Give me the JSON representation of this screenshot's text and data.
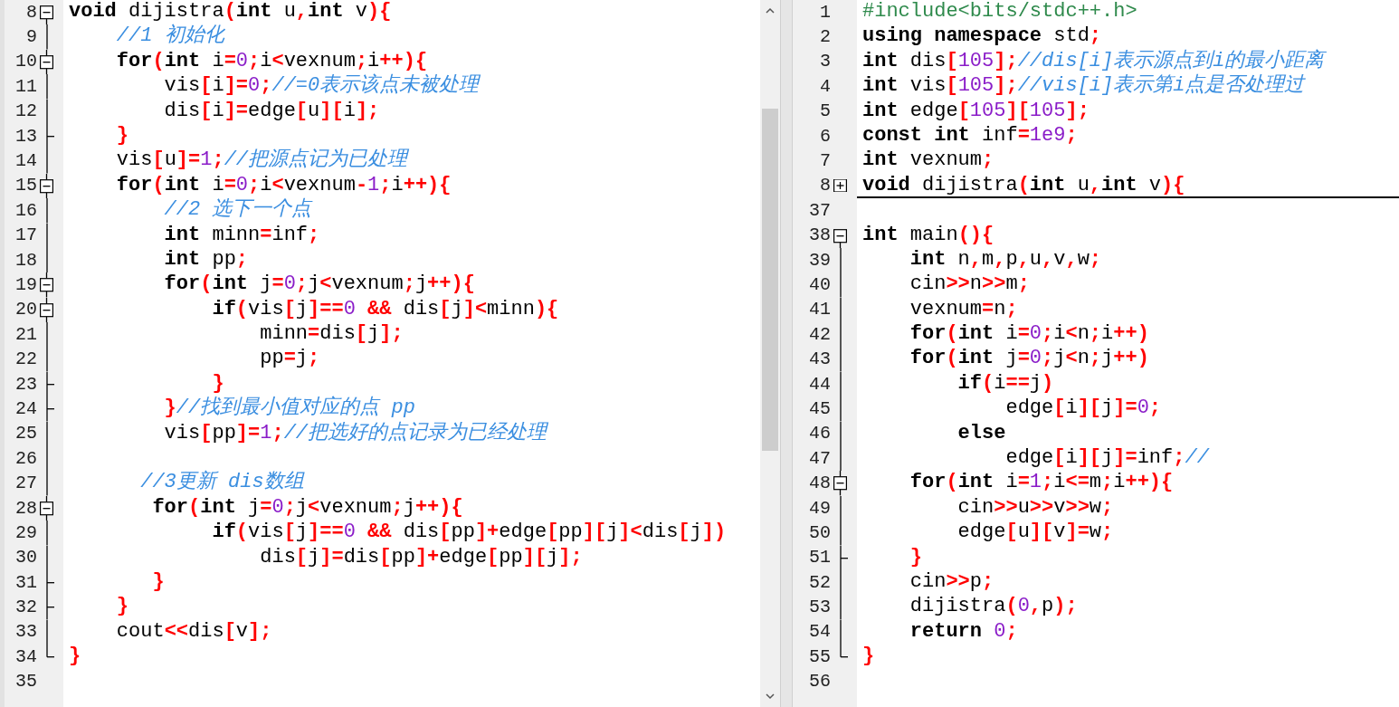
{
  "left_pane": {
    "lines": [
      {
        "number": "8",
        "kind": "start",
        "tokens": [
          {
            "kind": "keyword",
            "text": "void"
          },
          {
            "kind": "plain",
            "text": " dijistra"
          },
          {
            "kind": "symbol",
            "text": "("
          },
          {
            "kind": "keyword",
            "text": "int"
          },
          {
            "kind": "plain",
            "text": " u"
          },
          {
            "kind": "symbol",
            "text": ","
          },
          {
            "kind": "keyword",
            "text": "int"
          },
          {
            "kind": "plain",
            "text": " v"
          },
          {
            "kind": "symbol",
            "text": "){"
          }
        ]
      },
      {
        "number": "9",
        "kind": "line",
        "tokens": [
          {
            "kind": "comment",
            "text": "    //1 初始化"
          }
        ]
      },
      {
        "number": "10",
        "kind": "open",
        "tokens": [
          {
            "kind": "keyword",
            "text": "    for"
          },
          {
            "kind": "symbol",
            "text": "("
          },
          {
            "kind": "keyword",
            "text": "int"
          },
          {
            "kind": "plain",
            "text": " i"
          },
          {
            "kind": "symbol",
            "text": "="
          },
          {
            "kind": "number",
            "text": "0"
          },
          {
            "kind": "symbol",
            "text": ";"
          },
          {
            "kind": "plain",
            "text": "i"
          },
          {
            "kind": "symbol",
            "text": "<"
          },
          {
            "kind": "plain",
            "text": "vexnum"
          },
          {
            "kind": "symbol",
            "text": ";"
          },
          {
            "kind": "plain",
            "text": "i"
          },
          {
            "kind": "symbol",
            "text": "++){"
          }
        ]
      },
      {
        "number": "11",
        "kind": "line",
        "tokens": [
          {
            "kind": "plain",
            "text": "        vis"
          },
          {
            "kind": "symbol",
            "text": "["
          },
          {
            "kind": "plain",
            "text": "i"
          },
          {
            "kind": "symbol",
            "text": "]="
          },
          {
            "kind": "number",
            "text": "0"
          },
          {
            "kind": "symbol",
            "text": ";"
          },
          {
            "kind": "comment",
            "text": "//=0表示该点未被处理"
          }
        ]
      },
      {
        "number": "12",
        "kind": "line",
        "tokens": [
          {
            "kind": "plain",
            "text": "        dis"
          },
          {
            "kind": "symbol",
            "text": "["
          },
          {
            "kind": "plain",
            "text": "i"
          },
          {
            "kind": "symbol",
            "text": "]="
          },
          {
            "kind": "plain",
            "text": "edge"
          },
          {
            "kind": "symbol",
            "text": "["
          },
          {
            "kind": "plain",
            "text": "u"
          },
          {
            "kind": "symbol",
            "text": "]["
          },
          {
            "kind": "plain",
            "text": "i"
          },
          {
            "kind": "symbol",
            "text": "];"
          }
        ]
      },
      {
        "number": "13",
        "kind": "mid",
        "tokens": [
          {
            "kind": "symbol",
            "text": "    }"
          }
        ]
      },
      {
        "number": "14",
        "kind": "line",
        "tokens": [
          {
            "kind": "plain",
            "text": "    vis"
          },
          {
            "kind": "symbol",
            "text": "["
          },
          {
            "kind": "plain",
            "text": "u"
          },
          {
            "kind": "symbol",
            "text": "]="
          },
          {
            "kind": "number",
            "text": "1"
          },
          {
            "kind": "symbol",
            "text": ";"
          },
          {
            "kind": "comment",
            "text": "//把源点记为已处理"
          }
        ]
      },
      {
        "number": "15",
        "kind": "open",
        "tokens": [
          {
            "kind": "keyword",
            "text": "    for"
          },
          {
            "kind": "symbol",
            "text": "("
          },
          {
            "kind": "keyword",
            "text": "int"
          },
          {
            "kind": "plain",
            "text": " i"
          },
          {
            "kind": "symbol",
            "text": "="
          },
          {
            "kind": "number",
            "text": "0"
          },
          {
            "kind": "symbol",
            "text": ";"
          },
          {
            "kind": "plain",
            "text": "i"
          },
          {
            "kind": "symbol",
            "text": "<"
          },
          {
            "kind": "plain",
            "text": "vexnum"
          },
          {
            "kind": "symbol",
            "text": "-"
          },
          {
            "kind": "number",
            "text": "1"
          },
          {
            "kind": "symbol",
            "text": ";"
          },
          {
            "kind": "plain",
            "text": "i"
          },
          {
            "kind": "symbol",
            "text": "++){"
          }
        ]
      },
      {
        "number": "16",
        "kind": "line",
        "tokens": [
          {
            "kind": "comment",
            "text": "        //2 选下一个点"
          }
        ]
      },
      {
        "number": "17",
        "kind": "line",
        "tokens": [
          {
            "kind": "keyword",
            "text": "        int"
          },
          {
            "kind": "plain",
            "text": " minn"
          },
          {
            "kind": "symbol",
            "text": "="
          },
          {
            "kind": "plain",
            "text": "inf"
          },
          {
            "kind": "symbol",
            "text": ";"
          }
        ]
      },
      {
        "number": "18",
        "kind": "line",
        "tokens": [
          {
            "kind": "keyword",
            "text": "        int"
          },
          {
            "kind": "plain",
            "text": " pp"
          },
          {
            "kind": "symbol",
            "text": ";"
          }
        ]
      },
      {
        "number": "19",
        "kind": "open",
        "tokens": [
          {
            "kind": "keyword",
            "text": "        for"
          },
          {
            "kind": "symbol",
            "text": "("
          },
          {
            "kind": "keyword",
            "text": "int"
          },
          {
            "kind": "plain",
            "text": " j"
          },
          {
            "kind": "symbol",
            "text": "="
          },
          {
            "kind": "number",
            "text": "0"
          },
          {
            "kind": "symbol",
            "text": ";"
          },
          {
            "kind": "plain",
            "text": "j"
          },
          {
            "kind": "symbol",
            "text": "<"
          },
          {
            "kind": "plain",
            "text": "vexnum"
          },
          {
            "kind": "symbol",
            "text": ";"
          },
          {
            "kind": "plain",
            "text": "j"
          },
          {
            "kind": "symbol",
            "text": "++){"
          }
        ]
      },
      {
        "number": "20",
        "kind": "open",
        "tokens": [
          {
            "kind": "keyword",
            "text": "            if"
          },
          {
            "kind": "symbol",
            "text": "("
          },
          {
            "kind": "plain",
            "text": "vis"
          },
          {
            "kind": "symbol",
            "text": "["
          },
          {
            "kind": "plain",
            "text": "j"
          },
          {
            "kind": "symbol",
            "text": "]=="
          },
          {
            "kind": "number",
            "text": "0"
          },
          {
            "kind": "symbol",
            "text": " &&"
          },
          {
            "kind": "plain",
            "text": " dis"
          },
          {
            "kind": "symbol",
            "text": "["
          },
          {
            "kind": "plain",
            "text": "j"
          },
          {
            "kind": "symbol",
            "text": "]<"
          },
          {
            "kind": "plain",
            "text": "minn"
          },
          {
            "kind": "symbol",
            "text": "){"
          }
        ]
      },
      {
        "number": "21",
        "kind": "line",
        "tokens": [
          {
            "kind": "plain",
            "text": "                minn"
          },
          {
            "kind": "symbol",
            "text": "="
          },
          {
            "kind": "plain",
            "text": "dis"
          },
          {
            "kind": "symbol",
            "text": "["
          },
          {
            "kind": "plain",
            "text": "j"
          },
          {
            "kind": "symbol",
            "text": "];"
          }
        ]
      },
      {
        "number": "22",
        "kind": "line",
        "tokens": [
          {
            "kind": "plain",
            "text": "                pp"
          },
          {
            "kind": "symbol",
            "text": "="
          },
          {
            "kind": "plain",
            "text": "j"
          },
          {
            "kind": "symbol",
            "text": ";"
          }
        ]
      },
      {
        "number": "23",
        "kind": "mid",
        "tokens": [
          {
            "kind": "symbol",
            "text": "            }"
          }
        ]
      },
      {
        "number": "24",
        "kind": "mid",
        "tokens": [
          {
            "kind": "symbol",
            "text": "        }"
          },
          {
            "kind": "comment",
            "text": "//找到最小值对应的点 pp"
          }
        ]
      },
      {
        "number": "25",
        "kind": "line",
        "tokens": [
          {
            "kind": "plain",
            "text": "        vis"
          },
          {
            "kind": "symbol",
            "text": "["
          },
          {
            "kind": "plain",
            "text": "pp"
          },
          {
            "kind": "symbol",
            "text": "]="
          },
          {
            "kind": "number",
            "text": "1"
          },
          {
            "kind": "symbol",
            "text": ";"
          },
          {
            "kind": "comment",
            "text": "//把选好的点记录为已经处理"
          }
        ]
      },
      {
        "number": "26",
        "kind": "line"
      },
      {
        "number": "27",
        "kind": "line",
        "tokens": [
          {
            "kind": "comment",
            "text": "      //3更新 dis数组"
          }
        ]
      },
      {
        "number": "28",
        "kind": "open",
        "tokens": [
          {
            "kind": "keyword",
            "text": "       for"
          },
          {
            "kind": "symbol",
            "text": "("
          },
          {
            "kind": "keyword",
            "text": "int"
          },
          {
            "kind": "plain",
            "text": " j"
          },
          {
            "kind": "symbol",
            "text": "="
          },
          {
            "kind": "number",
            "text": "0"
          },
          {
            "kind": "symbol",
            "text": ";"
          },
          {
            "kind": "plain",
            "text": "j"
          },
          {
            "kind": "symbol",
            "text": "<"
          },
          {
            "kind": "plain",
            "text": "vexnum"
          },
          {
            "kind": "symbol",
            "text": ";"
          },
          {
            "kind": "plain",
            "text": "j"
          },
          {
            "kind": "symbol",
            "text": "++){"
          }
        ]
      },
      {
        "number": "29",
        "kind": "line",
        "tokens": [
          {
            "kind": "keyword",
            "text": "            if"
          },
          {
            "kind": "symbol",
            "text": "("
          },
          {
            "kind": "plain",
            "text": "vis"
          },
          {
            "kind": "symbol",
            "text": "["
          },
          {
            "kind": "plain",
            "text": "j"
          },
          {
            "kind": "symbol",
            "text": "]=="
          },
          {
            "kind": "number",
            "text": "0"
          },
          {
            "kind": "symbol",
            "text": " &&"
          },
          {
            "kind": "plain",
            "text": " dis"
          },
          {
            "kind": "symbol",
            "text": "["
          },
          {
            "kind": "plain",
            "text": "pp"
          },
          {
            "kind": "symbol",
            "text": "]+"
          },
          {
            "kind": "plain",
            "text": "edge"
          },
          {
            "kind": "symbol",
            "text": "["
          },
          {
            "kind": "plain",
            "text": "pp"
          },
          {
            "kind": "symbol",
            "text": "]["
          },
          {
            "kind": "plain",
            "text": "j"
          },
          {
            "kind": "symbol",
            "text": "]<"
          },
          {
            "kind": "plain",
            "text": "dis"
          },
          {
            "kind": "symbol",
            "text": "["
          },
          {
            "kind": "plain",
            "text": "j"
          },
          {
            "kind": "symbol",
            "text": "])"
          }
        ]
      },
      {
        "number": "30",
        "kind": "line",
        "tokens": [
          {
            "kind": "plain",
            "text": "                dis"
          },
          {
            "kind": "symbol",
            "text": "["
          },
          {
            "kind": "plain",
            "text": "j"
          },
          {
            "kind": "symbol",
            "text": "]="
          },
          {
            "kind": "plain",
            "text": "dis"
          },
          {
            "kind": "symbol",
            "text": "["
          },
          {
            "kind": "plain",
            "text": "pp"
          },
          {
            "kind": "symbol",
            "text": "]+"
          },
          {
            "kind": "plain",
            "text": "edge"
          },
          {
            "kind": "symbol",
            "text": "["
          },
          {
            "kind": "plain",
            "text": "pp"
          },
          {
            "kind": "symbol",
            "text": "]["
          },
          {
            "kind": "plain",
            "text": "j"
          },
          {
            "kind": "symbol",
            "text": "];"
          }
        ]
      },
      {
        "number": "31",
        "kind": "mid",
        "tokens": [
          {
            "kind": "symbol",
            "text": "       }"
          }
        ]
      },
      {
        "number": "32",
        "kind": "mid",
        "tokens": [
          {
            "kind": "symbol",
            "text": "    }"
          }
        ]
      },
      {
        "number": "33",
        "kind": "line",
        "tokens": [
          {
            "kind": "plain",
            "text": "    cout"
          },
          {
            "kind": "symbol",
            "text": "<<"
          },
          {
            "kind": "plain",
            "text": "dis"
          },
          {
            "kind": "symbol",
            "text": "["
          },
          {
            "kind": "plain",
            "text": "v"
          },
          {
            "kind": "symbol",
            "text": "];"
          }
        ]
      },
      {
        "number": "34",
        "kind": "end",
        "tokens": [
          {
            "kind": "symbol",
            "text": "}"
          }
        ]
      },
      {
        "number": "35",
        "kind": "none"
      }
    ]
  },
  "right_pane": {
    "lines": [
      {
        "number": "1",
        "kind": "none",
        "tokens": [
          {
            "kind": "directive",
            "text": "#include<bits/stdc++.h>"
          }
        ]
      },
      {
        "number": "2",
        "kind": "none",
        "tokens": [
          {
            "kind": "keyword",
            "text": "using namespace"
          },
          {
            "kind": "plain",
            "text": " std"
          },
          {
            "kind": "symbol",
            "text": ";"
          }
        ]
      },
      {
        "number": "3",
        "kind": "none",
        "tokens": [
          {
            "kind": "keyword",
            "text": "int"
          },
          {
            "kind": "plain",
            "text": " dis"
          },
          {
            "kind": "symbol",
            "text": "["
          },
          {
            "kind": "number",
            "text": "105"
          },
          {
            "kind": "symbol",
            "text": "];"
          },
          {
            "kind": "comment",
            "text": "//dis[i]表示源点到i的最小距离"
          }
        ]
      },
      {
        "number": "4",
        "kind": "none",
        "tokens": [
          {
            "kind": "keyword",
            "text": "int"
          },
          {
            "kind": "plain",
            "text": " vis"
          },
          {
            "kind": "symbol",
            "text": "["
          },
          {
            "kind": "number",
            "text": "105"
          },
          {
            "kind": "symbol",
            "text": "];"
          },
          {
            "kind": "comment",
            "text": "//vis[i]表示第i点是否处理过"
          }
        ]
      },
      {
        "number": "5",
        "kind": "none",
        "tokens": [
          {
            "kind": "keyword",
            "text": "int"
          },
          {
            "kind": "plain",
            "text": " edge"
          },
          {
            "kind": "symbol",
            "text": "["
          },
          {
            "kind": "number",
            "text": "105"
          },
          {
            "kind": "symbol",
            "text": "]["
          },
          {
            "kind": "number",
            "text": "105"
          },
          {
            "kind": "symbol",
            "text": "];"
          }
        ]
      },
      {
        "number": "6",
        "kind": "none",
        "tokens": [
          {
            "kind": "keyword",
            "text": "const int"
          },
          {
            "kind": "plain",
            "text": " inf"
          },
          {
            "kind": "symbol",
            "text": "="
          },
          {
            "kind": "number",
            "text": "1e9"
          },
          {
            "kind": "symbol",
            "text": ";"
          }
        ]
      },
      {
        "number": "7",
        "kind": "none",
        "tokens": [
          {
            "kind": "keyword",
            "text": "int"
          },
          {
            "kind": "plain",
            "text": " vexnum"
          },
          {
            "kind": "symbol",
            "text": ";"
          }
        ]
      },
      {
        "number": "8",
        "kind": "closed",
        "tokens": [
          {
            "kind": "keyword",
            "text": "void"
          },
          {
            "kind": "plain",
            "text": " dijistra"
          },
          {
            "kind": "symbol",
            "text": "("
          },
          {
            "kind": "keyword",
            "text": "int"
          },
          {
            "kind": "plain",
            "text": " u"
          },
          {
            "kind": "symbol",
            "text": ","
          },
          {
            "kind": "keyword",
            "text": "int"
          },
          {
            "kind": "plain",
            "text": " v"
          },
          {
            "kind": "symbol",
            "text": "){"
          }
        ]
      },
      {
        "number": "37",
        "kind": "none"
      },
      {
        "number": "38",
        "kind": "start",
        "tokens": [
          {
            "kind": "keyword",
            "text": "int"
          },
          {
            "kind": "plain",
            "text": " main"
          },
          {
            "kind": "symbol",
            "text": "(){"
          }
        ]
      },
      {
        "number": "39",
        "kind": "line",
        "tokens": [
          {
            "kind": "keyword",
            "text": "    int"
          },
          {
            "kind": "plain",
            "text": " n"
          },
          {
            "kind": "symbol",
            "text": ","
          },
          {
            "kind": "plain",
            "text": "m"
          },
          {
            "kind": "symbol",
            "text": ","
          },
          {
            "kind": "plain",
            "text": "p"
          },
          {
            "kind": "symbol",
            "text": ","
          },
          {
            "kind": "plain",
            "text": "u"
          },
          {
            "kind": "symbol",
            "text": ","
          },
          {
            "kind": "plain",
            "text": "v"
          },
          {
            "kind": "symbol",
            "text": ","
          },
          {
            "kind": "plain",
            "text": "w"
          },
          {
            "kind": "symbol",
            "text": ";"
          }
        ]
      },
      {
        "number": "40",
        "kind": "line",
        "tokens": [
          {
            "kind": "plain",
            "text": "    cin"
          },
          {
            "kind": "symbol",
            "text": ">>"
          },
          {
            "kind": "plain",
            "text": "n"
          },
          {
            "kind": "symbol",
            "text": ">>"
          },
          {
            "kind": "plain",
            "text": "m"
          },
          {
            "kind": "symbol",
            "text": ";"
          }
        ]
      },
      {
        "number": "41",
        "kind": "line",
        "tokens": [
          {
            "kind": "plain",
            "text": "    vexnum"
          },
          {
            "kind": "symbol",
            "text": "="
          },
          {
            "kind": "plain",
            "text": "n"
          },
          {
            "kind": "symbol",
            "text": ";"
          }
        ]
      },
      {
        "number": "42",
        "kind": "line",
        "tokens": [
          {
            "kind": "keyword",
            "text": "    for"
          },
          {
            "kind": "symbol",
            "text": "("
          },
          {
            "kind": "keyword",
            "text": "int"
          },
          {
            "kind": "plain",
            "text": " i"
          },
          {
            "kind": "symbol",
            "text": "="
          },
          {
            "kind": "number",
            "text": "0"
          },
          {
            "kind": "symbol",
            "text": ";"
          },
          {
            "kind": "plain",
            "text": "i"
          },
          {
            "kind": "symbol",
            "text": "<"
          },
          {
            "kind": "plain",
            "text": "n"
          },
          {
            "kind": "symbol",
            "text": ";"
          },
          {
            "kind": "plain",
            "text": "i"
          },
          {
            "kind": "symbol",
            "text": "++)"
          }
        ]
      },
      {
        "number": "43",
        "kind": "line",
        "tokens": [
          {
            "kind": "keyword",
            "text": "    for"
          },
          {
            "kind": "symbol",
            "text": "("
          },
          {
            "kind": "keyword",
            "text": "int"
          },
          {
            "kind": "plain",
            "text": " j"
          },
          {
            "kind": "symbol",
            "text": "="
          },
          {
            "kind": "number",
            "text": "0"
          },
          {
            "kind": "symbol",
            "text": ";"
          },
          {
            "kind": "plain",
            "text": "j"
          },
          {
            "kind": "symbol",
            "text": "<"
          },
          {
            "kind": "plain",
            "text": "n"
          },
          {
            "kind": "symbol",
            "text": ";"
          },
          {
            "kind": "plain",
            "text": "j"
          },
          {
            "kind": "symbol",
            "text": "++)"
          }
        ]
      },
      {
        "number": "44",
        "kind": "line",
        "tokens": [
          {
            "kind": "keyword",
            "text": "        if"
          },
          {
            "kind": "symbol",
            "text": "("
          },
          {
            "kind": "plain",
            "text": "i"
          },
          {
            "kind": "symbol",
            "text": "=="
          },
          {
            "kind": "plain",
            "text": "j"
          },
          {
            "kind": "symbol",
            "text": ")"
          }
        ]
      },
      {
        "number": "45",
        "kind": "line",
        "tokens": [
          {
            "kind": "plain",
            "text": "            edge"
          },
          {
            "kind": "symbol",
            "text": "["
          },
          {
            "kind": "plain",
            "text": "i"
          },
          {
            "kind": "symbol",
            "text": "]["
          },
          {
            "kind": "plain",
            "text": "j"
          },
          {
            "kind": "symbol",
            "text": "]="
          },
          {
            "kind": "number",
            "text": "0"
          },
          {
            "kind": "symbol",
            "text": ";"
          }
        ]
      },
      {
        "number": "46",
        "kind": "line",
        "tokens": [
          {
            "kind": "keyword",
            "text": "        else"
          }
        ]
      },
      {
        "number": "47",
        "kind": "line",
        "tokens": [
          {
            "kind": "plain",
            "text": "            edge"
          },
          {
            "kind": "symbol",
            "text": "["
          },
          {
            "kind": "plain",
            "text": "i"
          },
          {
            "kind": "symbol",
            "text": "]["
          },
          {
            "kind": "plain",
            "text": "j"
          },
          {
            "kind": "symbol",
            "text": "]="
          },
          {
            "kind": "plain",
            "text": "inf"
          },
          {
            "kind": "symbol",
            "text": ";"
          },
          {
            "kind": "comment",
            "text": "//"
          }
        ]
      },
      {
        "number": "48",
        "kind": "open",
        "tokens": [
          {
            "kind": "keyword",
            "text": "    for"
          },
          {
            "kind": "symbol",
            "text": "("
          },
          {
            "kind": "keyword",
            "text": "int"
          },
          {
            "kind": "plain",
            "text": " i"
          },
          {
            "kind": "symbol",
            "text": "="
          },
          {
            "kind": "number",
            "text": "1"
          },
          {
            "kind": "symbol",
            "text": ";"
          },
          {
            "kind": "plain",
            "text": "i"
          },
          {
            "kind": "symbol",
            "text": "<="
          },
          {
            "kind": "plain",
            "text": "m"
          },
          {
            "kind": "symbol",
            "text": ";"
          },
          {
            "kind": "plain",
            "text": "i"
          },
          {
            "kind": "symbol",
            "text": "++){"
          }
        ]
      },
      {
        "number": "49",
        "kind": "line",
        "tokens": [
          {
            "kind": "plain",
            "text": "        cin"
          },
          {
            "kind": "symbol",
            "text": ">>"
          },
          {
            "kind": "plain",
            "text": "u"
          },
          {
            "kind": "symbol",
            "text": ">>"
          },
          {
            "kind": "plain",
            "text": "v"
          },
          {
            "kind": "symbol",
            "text": ">>"
          },
          {
            "kind": "plain",
            "text": "w"
          },
          {
            "kind": "symbol",
            "text": ";"
          }
        ]
      },
      {
        "number": "50",
        "kind": "line",
        "tokens": [
          {
            "kind": "plain",
            "text": "        edge"
          },
          {
            "kind": "symbol",
            "text": "["
          },
          {
            "kind": "plain",
            "text": "u"
          },
          {
            "kind": "symbol",
            "text": "]["
          },
          {
            "kind": "plain",
            "text": "v"
          },
          {
            "kind": "symbol",
            "text": "]="
          },
          {
            "kind": "plain",
            "text": "w"
          },
          {
            "kind": "symbol",
            "text": ";"
          }
        ]
      },
      {
        "number": "51",
        "kind": "mid",
        "tokens": [
          {
            "kind": "symbol",
            "text": "    }"
          }
        ]
      },
      {
        "number": "52",
        "kind": "line",
        "tokens": [
          {
            "kind": "plain",
            "text": "    cin"
          },
          {
            "kind": "symbol",
            "text": ">>"
          },
          {
            "kind": "plain",
            "text": "p"
          },
          {
            "kind": "symbol",
            "text": ";"
          }
        ]
      },
      {
        "number": "53",
        "kind": "line",
        "tokens": [
          {
            "kind": "plain",
            "text": "    dijistra"
          },
          {
            "kind": "symbol",
            "text": "("
          },
          {
            "kind": "number",
            "text": "0"
          },
          {
            "kind": "symbol",
            "text": ","
          },
          {
            "kind": "plain",
            "text": "p"
          },
          {
            "kind": "symbol",
            "text": ");"
          }
        ]
      },
      {
        "number": "54",
        "kind": "line",
        "tokens": [
          {
            "kind": "keyword",
            "text": "    return"
          },
          {
            "kind": "number",
            "text": " 0"
          },
          {
            "kind": "symbol",
            "text": ";"
          }
        ]
      },
      {
        "number": "55",
        "kind": "end",
        "tokens": [
          {
            "kind": "symbol",
            "text": "}"
          }
        ]
      },
      {
        "number": "56",
        "kind": "none"
      }
    ]
  }
}
